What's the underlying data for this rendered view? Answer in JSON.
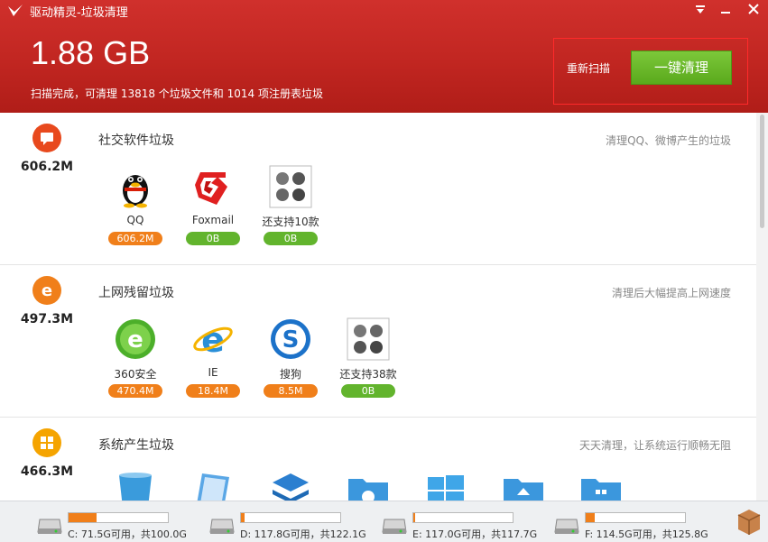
{
  "window": {
    "title": "驱动精灵-垃圾清理"
  },
  "summary": {
    "total": "1.88 GB",
    "text": "扫描完成，可清理 13818 个垃圾文件和 1014 项注册表垃圾",
    "rescan_label": "重新扫描",
    "clean_label": "一键清理"
  },
  "sections": [
    {
      "title": "社交软件垃圾",
      "size": "606.2M",
      "desc": "清理QQ、微博产生的垃圾",
      "items": [
        {
          "name": "QQ",
          "size": "606.2M",
          "icon": "qq-icon"
        },
        {
          "name": "Foxmail",
          "size": "0B",
          "icon": "foxmail-icon"
        },
        {
          "name": "还支持10款",
          "size": "0B",
          "icon": "more-apps-icon"
        }
      ]
    },
    {
      "title": "上网残留垃圾",
      "size": "497.3M",
      "desc": "清理后大幅提高上网速度",
      "items": [
        {
          "name": "360安全",
          "size": "470.4M",
          "icon": "360-browser-icon"
        },
        {
          "name": "IE",
          "size": "18.4M",
          "icon": "ie-icon"
        },
        {
          "name": "搜狗",
          "size": "8.5M",
          "icon": "sogou-icon"
        },
        {
          "name": "还支持38款",
          "size": "0B",
          "icon": "more-browsers-icon"
        }
      ]
    },
    {
      "title": "系统产生垃圾",
      "size": "466.3M",
      "desc": "天天清理，让系统运行顺畅无阻",
      "items": []
    }
  ],
  "disks": [
    {
      "label": "C: 71.5G可用，共100.0G",
      "used_fraction": 0.285
    },
    {
      "label": "D: 117.8G可用，共122.1G",
      "used_fraction": 0.035
    },
    {
      "label": "E: 117.0G可用，共117.7G",
      "used_fraction": 0.006
    },
    {
      "label": "F: 114.5G可用，共125.8G",
      "used_fraction": 0.09
    }
  ],
  "colors": {
    "header_red": "#c12621",
    "clean_green": "#62b42d",
    "badge_orange": "#f07f1a",
    "badge_green": "#62b42d"
  }
}
